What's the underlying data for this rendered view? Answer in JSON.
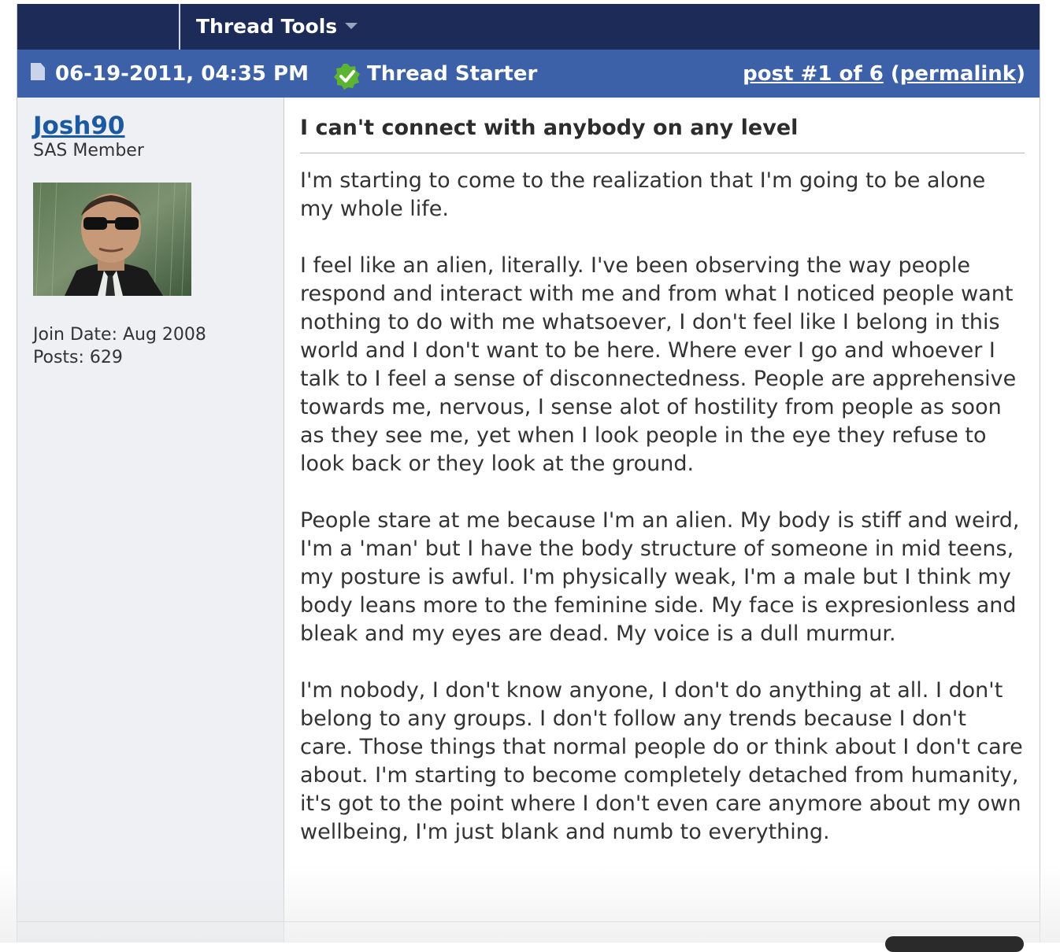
{
  "toolbar": {
    "thread_tools_label": "Thread Tools"
  },
  "post_header": {
    "date": "06-19-2011, 04:35 PM",
    "thread_starter_label": "Thread Starter",
    "post_number_link": "post #1 of 6",
    "open_paren": "(",
    "permalink_label": "permalink",
    "close_paren": ")"
  },
  "user": {
    "name": "Josh90",
    "title": "SAS Member",
    "join_date": "Join Date: Aug 2008",
    "posts": "Posts: 629"
  },
  "post": {
    "title": "I can't connect with anybody on any level",
    "paragraphs": [
      "I'm starting to come to the realization that I'm going to be alone my whole life.",
      "I feel like an alien, literally. I've been observing the way people respond and interact with me and from what I noticed people want nothing to do with me whatsoever, I don't feel like I belong in this world and I don't want to be here. Where ever I go and whoever I talk to I feel a sense of disconnectedness. People are apprehensive towards me, nervous, I sense alot of hostility from people as soon as they see me, yet when I look people in the eye they refuse to look back or they look at the ground.",
      "People stare at me because I'm an alien. My body is stiff and weird, I'm a 'man' but I have the body structure of someone in mid teens, my posture is awful. I'm physically weak, I'm a male but I think my body leans more to the feminine side. My face is expresionless and bleak and my eyes are dead. My voice is a dull murmur.",
      "I'm nobody, I don't know anyone, I don't do anything at all. I don't belong to any groups. I don't follow any trends because I don't care. Those things that normal people do or think about I don't care about. I'm starting to become completely detached from humanity, it's got to the point where I don't even care anymore about my own wellbeing, I'm just blank and numb to everything."
    ]
  },
  "icons": {
    "document": "document-icon",
    "check": "green-check-icon",
    "dropdown": "chevron-down-icon"
  },
  "colors": {
    "toolbar_bg": "#1c2b57",
    "header_bg": "#3d61a8",
    "sidebar_bg": "#eef0f4",
    "username_link": "#1b5aa0",
    "check_green": "#5cb531"
  }
}
